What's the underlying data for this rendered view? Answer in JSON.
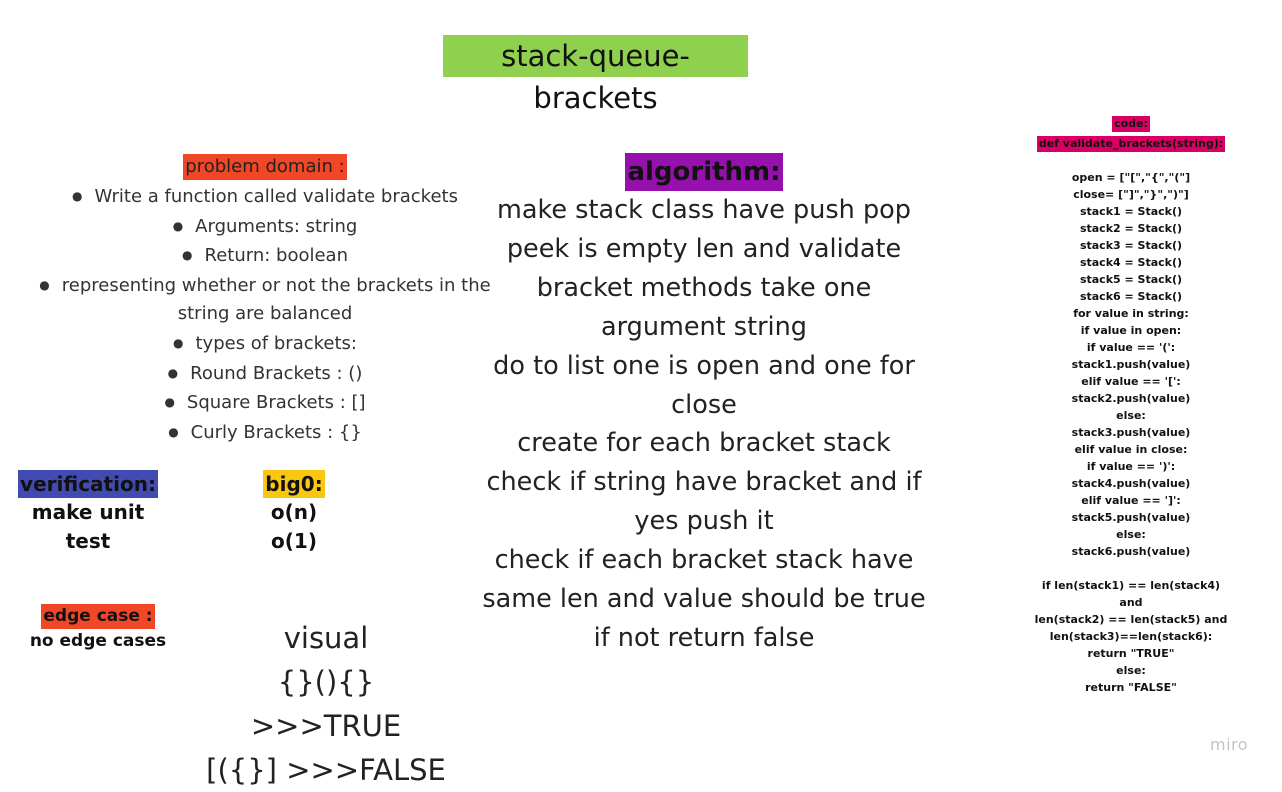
{
  "title": "stack-queue-brackets",
  "problem_domain": {
    "heading": "problem domain :",
    "items": [
      "Write a function called validate brackets",
      "Arguments: string",
      "Return: boolean",
      "representing whether or not the brackets in the",
      "string are balanced",
      "types of brackets:",
      "Round Brackets : ()",
      "Square Brackets : []",
      "Curly Brackets : {}"
    ]
  },
  "algorithm": {
    "heading": "algorithm:",
    "lines": [
      "make stack class have push pop",
      "peek is empty  len and validate",
      "bracket methods take one",
      "argument string",
      "do to list one is open and one for",
      "close",
      "create for each bracket stack",
      "check if string have bracket and if",
      "yes push it",
      "check if each bracket stack have",
      "same len and value should be true",
      "if not return false"
    ]
  },
  "verification": {
    "heading": "verification:",
    "lines": [
      "make unit",
      "test"
    ]
  },
  "big0": {
    "heading": "big0:",
    "lines": [
      "o(n)",
      "o(1)"
    ]
  },
  "edge_case": {
    "heading": "edge case :",
    "body": "no edge cases"
  },
  "visual": {
    "lines": [
      "visual",
      "{}(){} >>>TRUE",
      "[({}] >>>FALSE"
    ]
  },
  "code": {
    "heading": "code:",
    "signature": "def validate_brackets(string):",
    "lines": [
      "",
      "open = [\"[\",\"{\",\"(\"]",
      "close= [\"]\",\"}\",\")\"]",
      "stack1 = Stack()",
      "stack2 = Stack()",
      "stack3 = Stack()",
      "stack4 = Stack()",
      "stack5 = Stack()",
      "stack6 = Stack()",
      "for value in string:",
      "if value in open:",
      "if value == '(':",
      "stack1.push(value)",
      "elif value == '[':",
      "stack2.push(value)",
      "else:",
      "stack3.push(value)",
      "elif value in close:",
      "if value == ')':",
      "stack4.push(value)",
      "elif value == ']':",
      "stack5.push(value)",
      "else:",
      "stack6.push(value)",
      "",
      "if len(stack1) == len(stack4) and",
      "len(stack2) == len(stack5) and",
      "len(stack3)==len(stack6):",
      "return \"TRUE\"",
      "else:",
      "return \"FALSE\""
    ]
  },
  "brand": "miro",
  "colors": {
    "title_bg": "#8fd14f",
    "problem_domain_bg": "#f24726",
    "algorithm_bg": "#9510ac",
    "verification_bg": "#414bb2",
    "big0_bg": "#fac710",
    "edge_case_bg": "#f24726",
    "code_bg": "#da0063"
  }
}
